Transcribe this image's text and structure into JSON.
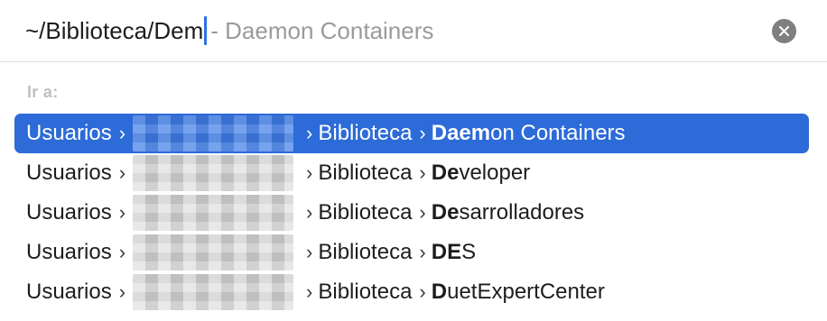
{
  "search": {
    "typed": "~/Biblioteca/Dem",
    "suggestion": " - Daemon Containers"
  },
  "section_label": "Ir a:",
  "results": [
    {
      "root": "Usuarios",
      "folder": "Biblioteca",
      "match": "Daem",
      "rest": "on Containers",
      "selected": true
    },
    {
      "root": "Usuarios",
      "folder": "Biblioteca",
      "match": "De",
      "rest": "veloper",
      "selected": false
    },
    {
      "root": "Usuarios",
      "folder": "Biblioteca",
      "match": "De",
      "rest": "sarrolladores",
      "selected": false
    },
    {
      "root": "Usuarios",
      "folder": "Biblioteca",
      "match": "DE",
      "rest": "S",
      "selected": false
    },
    {
      "root": "Usuarios",
      "folder": "Biblioteca",
      "match": "D",
      "rest": "uetExpertCenter",
      "selected": false
    }
  ],
  "separator": "›",
  "icons": {
    "clear": "clear-circle-icon"
  },
  "colors": {
    "selection": "#2c6bd8",
    "caret": "#2a72e6"
  }
}
